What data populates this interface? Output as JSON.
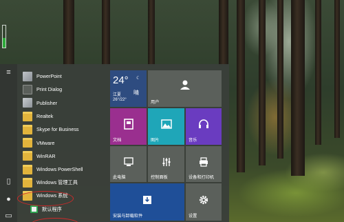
{
  "start_menu": {
    "apps": [
      {
        "label": "PowerPoint",
        "icon": "powerpoint-icon"
      },
      {
        "label": "Print Dialog",
        "icon": "print-dialog-icon"
      },
      {
        "label": "Publisher",
        "icon": "publisher-icon"
      },
      {
        "label": "Realtek",
        "icon": "folder-icon"
      },
      {
        "label": "Skype for Business",
        "icon": "folder-icon"
      },
      {
        "label": "VMware",
        "icon": "folder-icon"
      },
      {
        "label": "WinRAR",
        "icon": "folder-icon"
      },
      {
        "label": "Windows PowerShell",
        "icon": "folder-icon"
      },
      {
        "label": "Windows 管理工具",
        "icon": "folder-icon"
      },
      {
        "label": "Windows 系统",
        "icon": "folder-icon"
      },
      {
        "label": "默认程序",
        "icon": "default-programs-icon"
      }
    ],
    "tiles": {
      "weather": {
        "temp": "24°",
        "city": "江夏",
        "condition": "晴",
        "range": "26°/22°"
      },
      "user": {
        "label": "用户"
      },
      "documents": {
        "label": "文档"
      },
      "pictures": {
        "label": "图片"
      },
      "music": {
        "label": "音乐"
      },
      "this_pc": {
        "label": "此电脑"
      },
      "control_panel": {
        "label": "控制面板"
      },
      "devices": {
        "label": "设备和打印机"
      },
      "programs": {
        "label": "安装与卸载软件"
      },
      "settings": {
        "label": "设置"
      }
    }
  },
  "colors": {
    "menu_bg": "#3a3f3a",
    "weather_tile": "#2e4c80",
    "gray_tile": "#5b605b",
    "documents_tile": "#9a2f8f",
    "pictures_tile": "#1fa6b8",
    "music_tile": "#6a3cc0",
    "programs_tile": "#1f4f98",
    "annotation_ring": "#d02a2a"
  }
}
